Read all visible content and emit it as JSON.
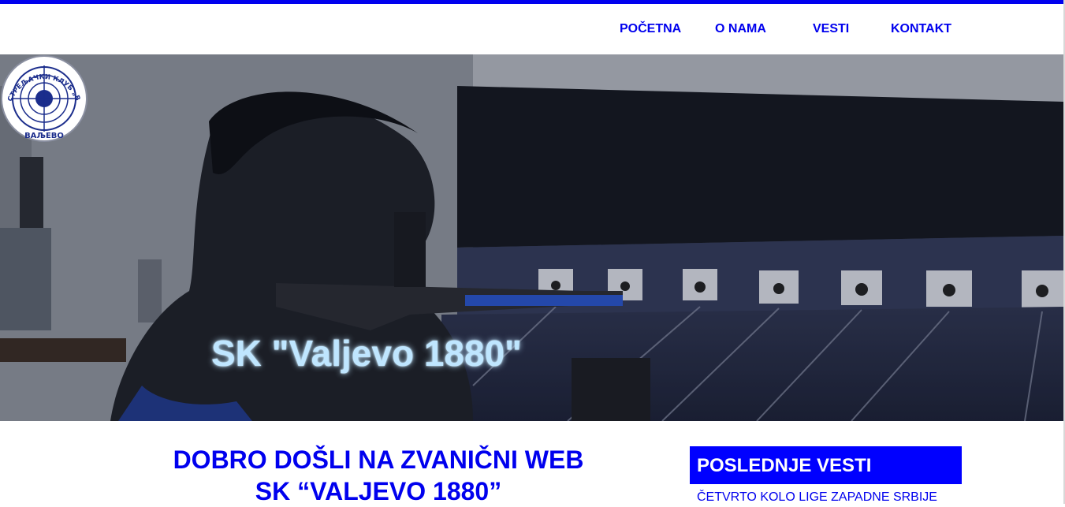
{
  "nav": {
    "items": [
      {
        "label": "POČETNA"
      },
      {
        "label": "O NAMA"
      },
      {
        "label": "VESTI"
      },
      {
        "label": "KONTAKT"
      }
    ]
  },
  "hero": {
    "title": "SK \"Valjevo 1880\"",
    "logo": {
      "ring_text_left": "СТРЕЉАЧКИ КЛУБ „ВАЉЕВО 1880\"",
      "ring_text_bottom": "ВАЉЕВО"
    }
  },
  "welcome": {
    "line1": "DOBRO DOŠLI NA ZVANIČNI WEB",
    "line2": "SK “VALJEVO 1880”"
  },
  "sidebar": {
    "news_heading": "POSLEDNJE VESTI",
    "latest_item": "ČETVRTO KOLO LIGE ZAPADNE SRBIJE"
  },
  "colors": {
    "accent": "#0000ee",
    "heading_bg": "#0000ff",
    "hero_title": "#bfe6ff"
  }
}
